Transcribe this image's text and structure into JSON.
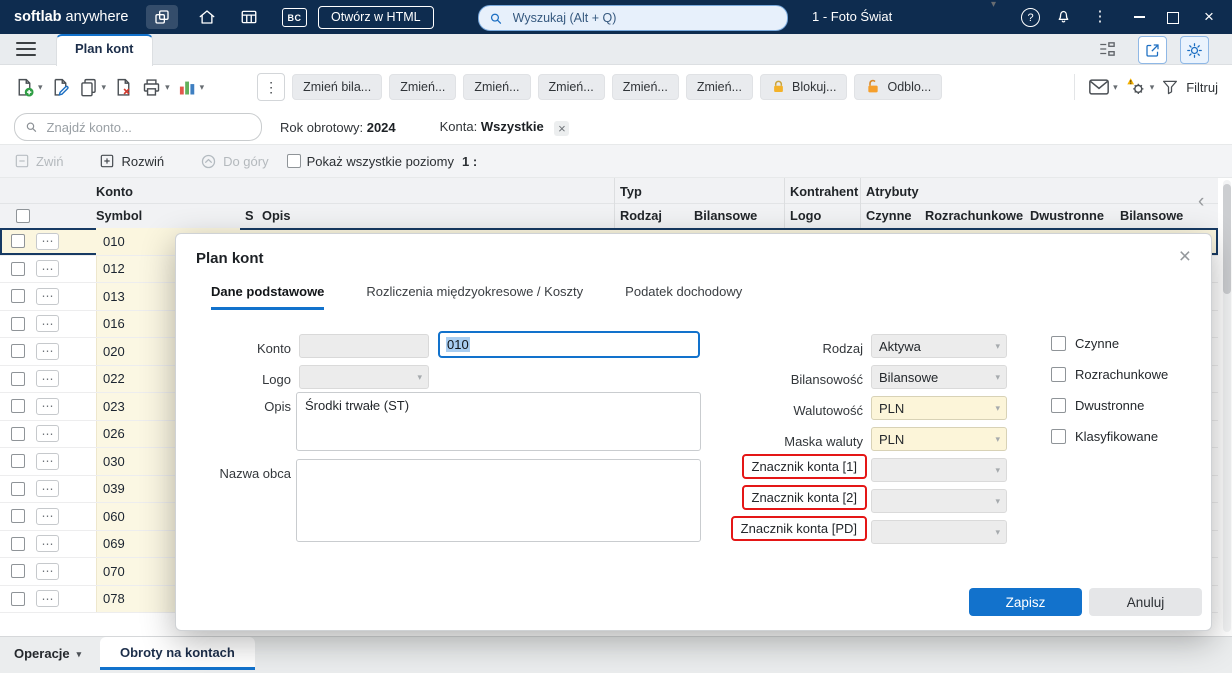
{
  "icons": {
    "kebab": "⋮",
    "row_ellipsis": "⋯",
    "chevron_down": "▾",
    "close_x": "×",
    "window_close": "×",
    "help": "?",
    "collapse_left": "‹",
    "filter_remove": "×",
    "bc": "BC"
  },
  "topbar": {
    "brand_primary": "softlab",
    "brand_secondary": " anywhere",
    "open_html_button": "Otwórz w HTML",
    "search_placeholder": "Wyszukaj (Alt + Q)",
    "company": "1 - Foto Świat"
  },
  "tabbar": {
    "active_tab": "Plan kont"
  },
  "toolbar": {
    "zmien_buttons": [
      "Zmień bila...",
      "Zmień...",
      "Zmień...",
      "Zmień...",
      "Zmień...",
      "Zmień..."
    ],
    "lock_button": "Blokuj...",
    "unlock_button": "Odblo...",
    "filter_button": "Filtruj"
  },
  "filters": {
    "search_placeholder": "Znajdź konto...",
    "year_label": "Rok obrotowy:",
    "year_value": "2024",
    "accounts_label": "Konta:",
    "accounts_value": "Wszystkie"
  },
  "gridbar": {
    "collapse": "Zwiń",
    "expand": "Rozwiń",
    "to_top": "Do góry",
    "show_all_levels": "Pokaż wszystkie poziomy",
    "level": "1 :"
  },
  "table": {
    "group_headers": {
      "konto": "Konto",
      "typ": "Typ",
      "kontrahent": "Kontrahent",
      "atrybuty": "Atrybuty"
    },
    "columns": [
      "Symbol",
      "S",
      "Opis",
      "Rodzaj",
      "Bilansowe",
      "Logo",
      "Czynne",
      "Rozrachunkowe",
      "Dwustronne",
      "Bilansowe"
    ],
    "rows": [
      "010",
      "012",
      "013",
      "016",
      "020",
      "022",
      "023",
      "026",
      "030",
      "039",
      "060",
      "069",
      "070",
      "078"
    ],
    "selected_symbol": "010"
  },
  "modal": {
    "title": "Plan kont",
    "tabs": [
      "Dane podstawowe",
      "Rozliczenia międzyokresowe / Koszty",
      "Podatek dochodowy"
    ],
    "active_tab": "Dane podstawowe",
    "fields": {
      "konto_label": "Konto",
      "konto_value": "010",
      "logo_label": "Logo",
      "opis_label": "Opis",
      "opis_value": "Środki trwałe (ST)",
      "nazwa_obca_label": "Nazwa obca",
      "rodzaj_label": "Rodzaj",
      "rodzaj_value": "Aktywa",
      "bilansowosc_label": "Bilansowość",
      "bilansowosc_value": "Bilansowe",
      "walutowosc_label": "Walutowość",
      "walutowosc_value": "PLN",
      "maska_waluty_label": "Maska waluty",
      "maska_waluty_value": "PLN",
      "znacznik_1_label": "Znacznik konta [1]",
      "znacznik_2_label": "Znacznik konta [2]",
      "znacznik_pd_label": "Znacznik konta [PD]"
    },
    "checkboxes": [
      "Czynne",
      "Rozrachunkowe",
      "Dwustronne",
      "Klasyfikowane"
    ],
    "save_button": "Zapisz",
    "cancel_button": "Anuluj"
  },
  "bottombar": {
    "operations": "Operacje",
    "active_tab": "Obroty na kontach"
  },
  "colors": {
    "topbar_bg": "#0e2c4f",
    "accent_blue": "#1272cc",
    "row_highlight": "#fbf7e3",
    "annotation_red": "#e41616",
    "lock_yellow": "#f3b229",
    "lock_orange": "#f59f2c"
  }
}
